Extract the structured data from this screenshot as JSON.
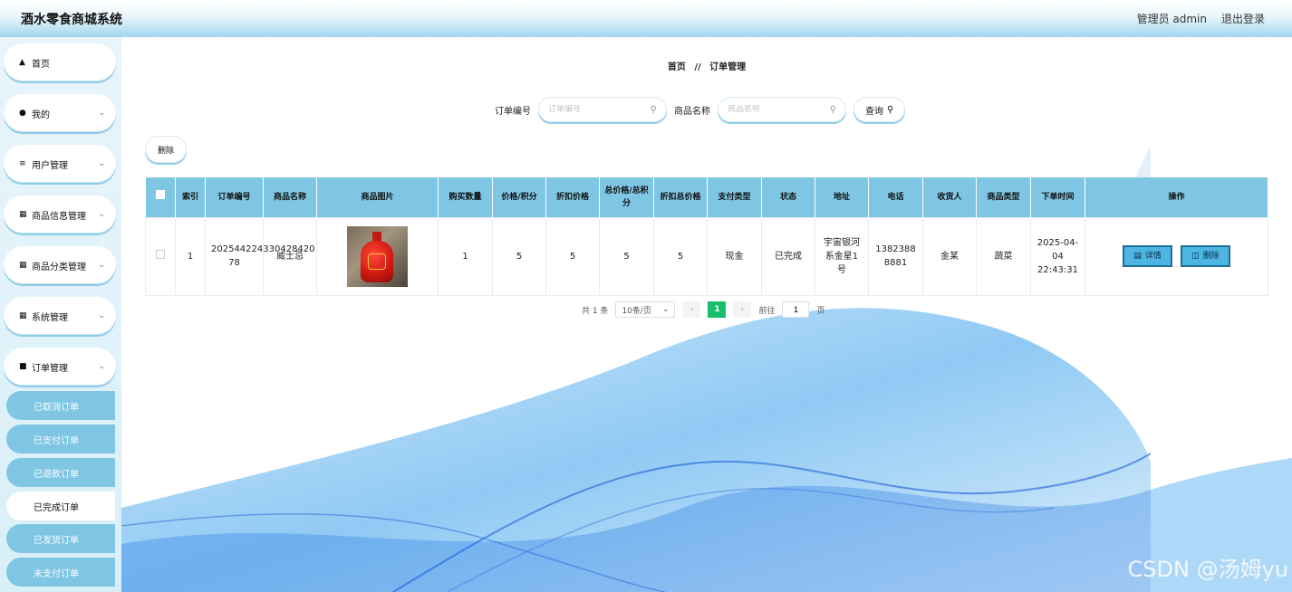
{
  "header": {
    "title": "酒水零食商城系统",
    "user_label": "管理员 admin",
    "logout_label": "退出登录"
  },
  "sidebar": {
    "items": [
      {
        "icon": "home-icon",
        "label": "首页"
      },
      {
        "icon": "user-icon",
        "label": "我的"
      },
      {
        "icon": "list-icon",
        "label": "用户管理"
      },
      {
        "icon": "grid-icon",
        "label": "商品信息管理"
      },
      {
        "icon": "grid-icon",
        "label": "商品分类管理"
      },
      {
        "icon": "grid-icon",
        "label": "系统管理"
      },
      {
        "icon": "chat-icon",
        "label": "订单管理"
      }
    ],
    "sub_items": [
      {
        "label": "已取消订单",
        "active": false
      },
      {
        "label": "已支付订单",
        "active": false
      },
      {
        "label": "已退款订单",
        "active": false
      },
      {
        "label": "已完成订单",
        "active": true
      },
      {
        "label": "已发货订单",
        "active": false
      },
      {
        "label": "未支付订单",
        "active": false
      }
    ]
  },
  "breadcrumb": {
    "home": "首页",
    "separator": "//",
    "current": "订单管理"
  },
  "search": {
    "order_no_label": "订单编号",
    "order_no_placeholder": "订单编号",
    "product_name_label": "商品名称",
    "product_name_placeholder": "商品名称",
    "query_label": "查询"
  },
  "toolbar": {
    "delete_label": "删除"
  },
  "table": {
    "columns": [
      "索引",
      "订单编号",
      "商品名称",
      "商品图片",
      "购买数量",
      "价格/积分",
      "折扣价格",
      "总价格/总积分",
      "折扣总价格",
      "支付类型",
      "状态",
      "地址",
      "电话",
      "收货人",
      "商品类型",
      "下单时间",
      "操作"
    ],
    "rows": [
      {
        "index": "1",
        "order_no": "202544224330428420 78",
        "product_name": "威士忌",
        "quantity": "1",
        "price": "5",
        "discount_price": "5",
        "total_price": "5",
        "discount_total": "5",
        "pay_type": "现金",
        "status": "已完成",
        "address": "宇宙银河系金星1号",
        "phone": "13823888881",
        "receiver": "金某",
        "product_type": "蔬菜",
        "order_time": "2025-04-04 22:43:31",
        "detail_label": "详情",
        "delete_label": "删除"
      }
    ]
  },
  "pagination": {
    "total_text": "共 1 条",
    "page_size": "10条/页",
    "current_page": "1",
    "goto_label": "前往",
    "goto_value": "1",
    "page_suffix": "页"
  },
  "watermark": "CSDN @汤姆yu",
  "colors": {
    "accent": "#7ec6e4",
    "pager_active": "#19be6b",
    "op_button": "#4cb5e2"
  }
}
